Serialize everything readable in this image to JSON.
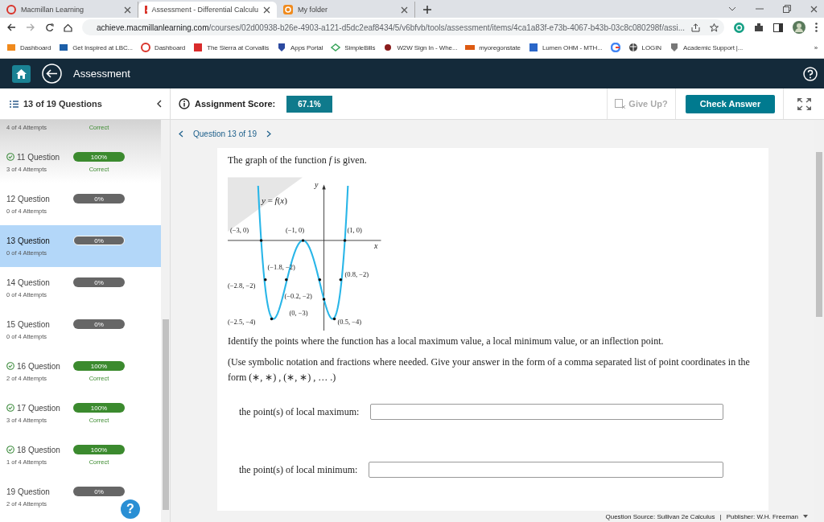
{
  "browser": {
    "tabs": [
      {
        "title": "Macmillan Learning",
        "selected": false
      },
      {
        "title": "Assessment - Differential Calculu",
        "selected": true
      },
      {
        "title": "My folder",
        "selected": false
      }
    ],
    "url_host": "achieve.macmillanlearning.com",
    "url_path": "/courses/02d00938-b26e-4903-a121-d5dc2eaf8434/5/v6bfvb/tools/assessment/items/4ca1a83f-e73b-4067-b43b-03c8c080298f/assi...",
    "bookmarks": [
      {
        "kind": "link",
        "label": "Dashboard"
      },
      {
        "kind": "link",
        "label": "Get Inspired at LBC..."
      },
      {
        "kind": "link",
        "label": "Dashboard"
      },
      {
        "kind": "link",
        "label": "The Sierra at Corvallis"
      },
      {
        "kind": "link",
        "label": "Apps Portal"
      },
      {
        "kind": "link",
        "label": "SimpleBills"
      },
      {
        "kind": "link",
        "label": "W2W Sign In - Whe..."
      },
      {
        "kind": "link",
        "label": "myoregonstate"
      },
      {
        "kind": "link",
        "label": "Lumen OHM - MTH..."
      },
      {
        "kind": "icon"
      },
      {
        "kind": "link",
        "label": "LOGIN"
      },
      {
        "kind": "link",
        "label": "Academic Support |..."
      }
    ],
    "overflow": "»"
  },
  "header": {
    "title": "Assessment"
  },
  "toolbar": {
    "question_count": "13 of 19 Questions",
    "score_label": "Assignment Score:",
    "score": "67.1%",
    "give_up": {
      "label": "Give Up?",
      "disabled": true
    },
    "check_answer": "Check Answer"
  },
  "sidebar": {
    "items": [
      {
        "attempts": "4 of 4 Attempts",
        "status": "Correct",
        "selected": false
      },
      {
        "title": "11 Question",
        "attempts": "3 of 4 Attempts",
        "score": "100%",
        "status": "Correct",
        "correct": true,
        "selected": false
      },
      {
        "title": "12 Question",
        "attempts": "0 of 4 Attempts",
        "score": "0%",
        "correct": false,
        "selected": false
      },
      {
        "title": "13 Question",
        "attempts": "0 of 4 Attempts",
        "score": "0%",
        "correct": false,
        "selected": true
      },
      {
        "title": "14 Question",
        "attempts": "0 of 4 Attempts",
        "score": "0%",
        "correct": false,
        "selected": false
      },
      {
        "title": "15 Question",
        "attempts": "0 of 4 Attempts",
        "score": "0%",
        "correct": false,
        "selected": false
      },
      {
        "title": "16 Question",
        "attempts": "2 of 4 Attempts",
        "score": "100%",
        "status": "Correct",
        "correct": true,
        "selected": false
      },
      {
        "title": "17 Question",
        "attempts": "3 of 4 Attempts",
        "score": "100%",
        "status": "Correct",
        "correct": true,
        "selected": false
      },
      {
        "title": "18 Question",
        "attempts": "1 of 4 Attempts",
        "score": "100%",
        "status": "Correct",
        "correct": true,
        "selected": false
      },
      {
        "title": "19 Question",
        "attempts": "2 of 4 Attempts",
        "score": "0%",
        "correct": false,
        "selected": false
      }
    ]
  },
  "help_button": "?",
  "question": {
    "nav_label": "Question 13 of 19",
    "intro": "The graph of the function *f* is given.",
    "graph": {
      "function_label": "*y* = *f*(*x*)",
      "x_axis": "x",
      "y_axis": "y",
      "points": [
        "(−3, 0)",
        "(−1, 0)",
        "(1, 0)",
        "(−1.8, −2)",
        "(−2.8, −2)",
        "(0.8, −2)",
        "(−0.2, −2)",
        "(0, −3)",
        "(−2.5, −4)",
        "(0.5, −4)"
      ]
    },
    "prompt": "Identify the points where the function has a local maximum value, a local minimum value, or an inflection point.",
    "instructions": "(Use symbolic notation and fractions where needed. Give your answer in the form of a comma separated list of point coordinates in the form (∗, ∗) , (∗, ∗) , … .)",
    "answers": [
      {
        "label": "the point(s) of local maximum:"
      },
      {
        "label": "the point(s) of local minimum:"
      }
    ]
  },
  "footer": {
    "source": "Question Source: Sullivan 2e Calculus",
    "separator": "|",
    "publisher": "Publisher: W.H. Freeman"
  }
}
